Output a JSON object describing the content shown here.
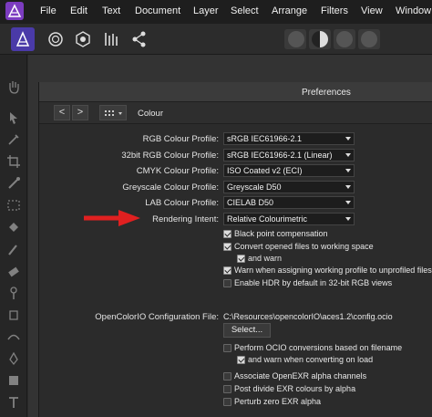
{
  "menubar": {
    "items": [
      "File",
      "Edit",
      "Text",
      "Document",
      "Layer",
      "Select",
      "Arrange",
      "Filters",
      "View",
      "Window"
    ]
  },
  "toolbar": {
    "personas": [
      "designer-persona",
      "pixel-persona",
      "export-persona",
      "equalizer-icon",
      "share-icon"
    ],
    "accent": "#4a3aa8"
  },
  "dialog": {
    "title": "Preferences",
    "nav_back": "<",
    "nav_forward": ">",
    "section": "Colour",
    "profiles": [
      {
        "label": "RGB Colour Profile:",
        "value": "sRGB IEC61966-2.1"
      },
      {
        "label": "32bit RGB Colour Profile:",
        "value": "sRGB IEC61966-2.1 (Linear)"
      },
      {
        "label": "CMYK Colour Profile:",
        "value": "ISO Coated v2 (ECI)"
      },
      {
        "label": "Greyscale Colour Profile:",
        "value": "Greyscale D50"
      },
      {
        "label": "LAB Colour Profile:",
        "value": "CIELAB D50"
      },
      {
        "label": "Rendering Intent:",
        "value": "Relative Colourimetric"
      }
    ],
    "options": [
      {
        "label": "Black point compensation",
        "checked": true
      },
      {
        "label": "Convert opened files to working space",
        "checked": true
      },
      {
        "label": "and warn",
        "checked": true
      },
      {
        "label": "Warn when assigning working profile to unprofiled files",
        "checked": true
      },
      {
        "label": "Enable HDR by default in 32-bit RGB views",
        "checked": false
      }
    ],
    "ocio_label": "OpenColorIO Configuration File:",
    "ocio_path": "C:\\Resources\\opencolorIO\\aces1.2\\config.ocio",
    "select_label": "Select...",
    "ocio_options": [
      {
        "label": "Perform OCIO conversions based on filename",
        "checked": false
      },
      {
        "label": "and warn when converting on load",
        "checked": true
      },
      {
        "label": "Associate OpenEXR alpha channels",
        "checked": false
      },
      {
        "label": "Post divide EXR colours by alpha",
        "checked": false
      },
      {
        "label": "Perturb zero EXR alpha",
        "checked": false
      }
    ]
  },
  "annotation": {
    "arrow_color": "#e02020"
  }
}
